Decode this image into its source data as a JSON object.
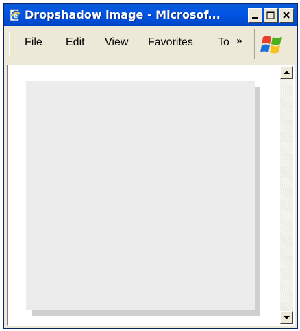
{
  "window": {
    "title": "Dropshadow image - Microsof...",
    "buttons": {
      "minimize": "minimize",
      "maximize": "maximize",
      "close": "close"
    }
  },
  "menu": {
    "items": [
      {
        "label": "File"
      },
      {
        "label": "Edit"
      },
      {
        "label": "View"
      },
      {
        "label": "Favorites"
      },
      {
        "label": "To"
      }
    ],
    "overflow": "»"
  },
  "colors": {
    "titlebar": "#0055e5",
    "chrome": "#ece9d8",
    "image_fill": "#ececec",
    "shadow": "#cfcfcf"
  },
  "icons": {
    "title": "ie-page-icon",
    "logo": "windows-flag-icon",
    "scroll_up": "scroll-up-arrow-icon",
    "scroll_down": "scroll-down-arrow-icon"
  }
}
